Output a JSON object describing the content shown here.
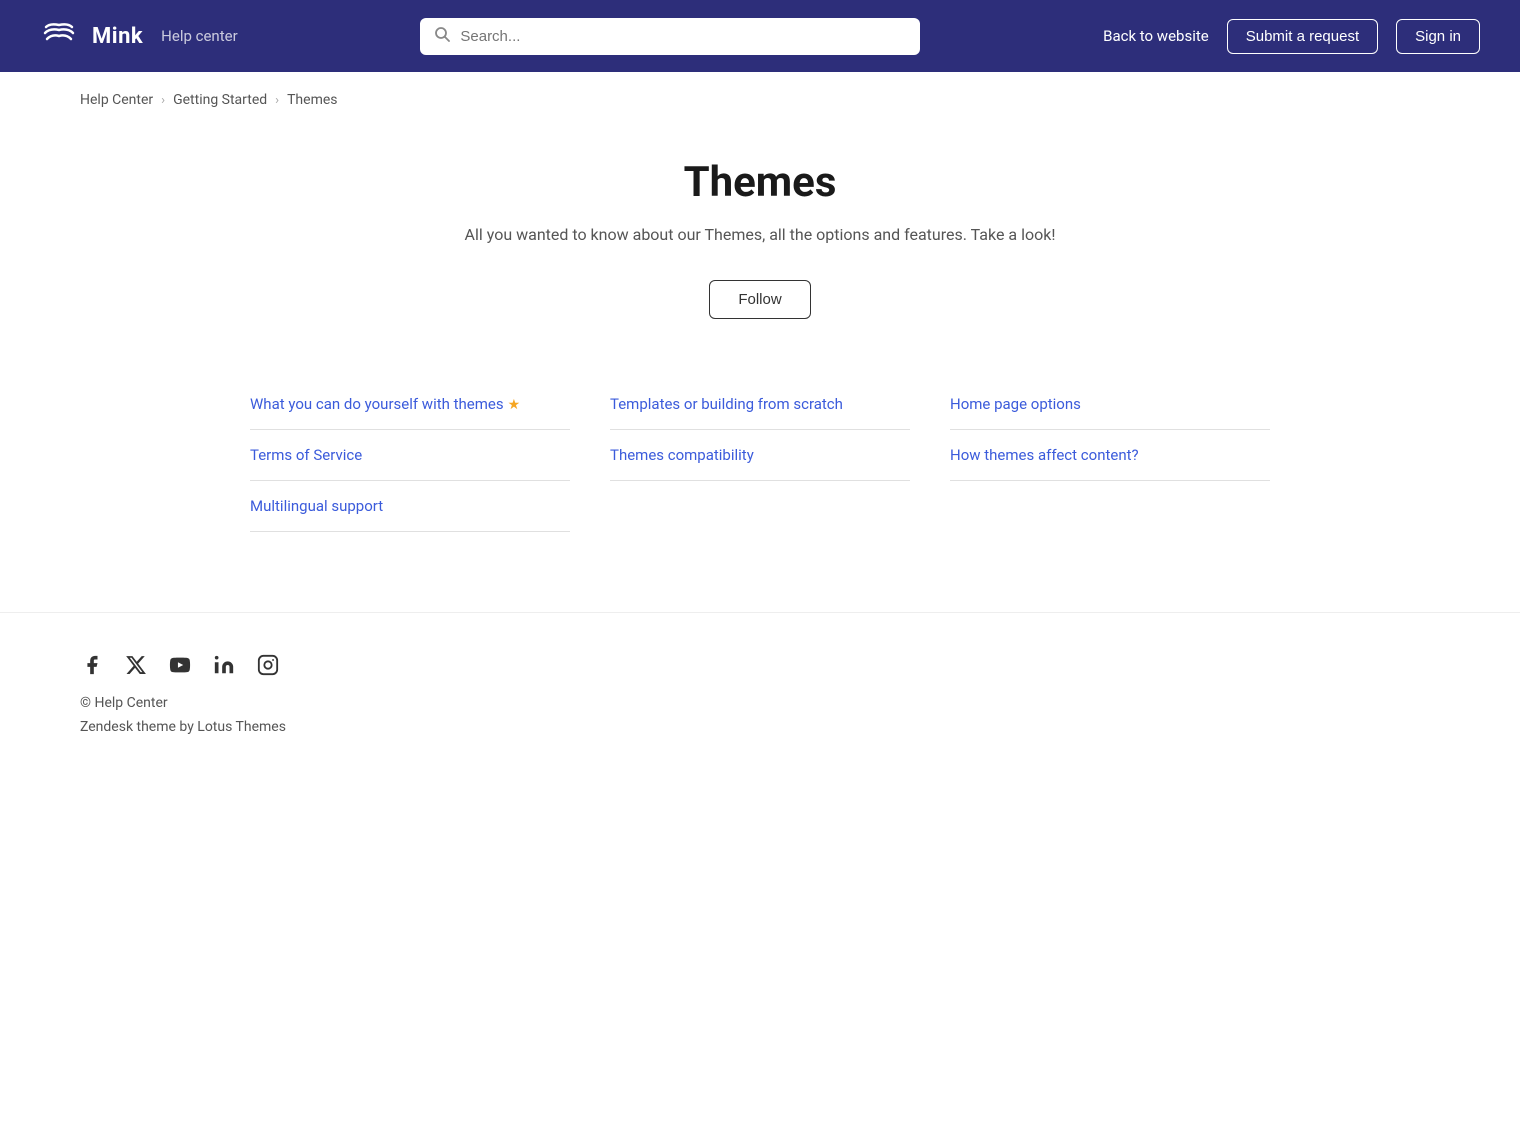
{
  "header": {
    "logo_text": "Mink",
    "help_center_label": "Help center",
    "search_placeholder": "Search...",
    "back_to_website": "Back to website",
    "submit_request": "Submit a request",
    "sign_in": "Sign in"
  },
  "breadcrumb": {
    "items": [
      {
        "label": "Help Center",
        "href": "#"
      },
      {
        "label": "Getting Started",
        "href": "#"
      },
      {
        "label": "Themes",
        "href": "#"
      }
    ]
  },
  "page": {
    "title": "Themes",
    "subtitle": "All you wanted to know about our Themes, all the options and features. Take a look!",
    "follow_label": "Follow"
  },
  "articles": {
    "columns": [
      {
        "items": [
          {
            "label": "What you can do yourself with themes",
            "star": true,
            "href": "#"
          },
          {
            "label": "Terms of Service",
            "star": false,
            "href": "#"
          },
          {
            "label": "Multilingual support",
            "star": false,
            "href": "#"
          }
        ]
      },
      {
        "items": [
          {
            "label": "Templates or building from scratch",
            "star": false,
            "href": "#"
          },
          {
            "label": "Themes compatibility",
            "star": false,
            "href": "#"
          }
        ]
      },
      {
        "items": [
          {
            "label": "Home page options",
            "star": false,
            "href": "#"
          },
          {
            "label": "How themes affect content?",
            "star": false,
            "href": "#"
          }
        ]
      }
    ]
  },
  "footer": {
    "copyright": "© Help Center",
    "theme_credit": "Zendesk theme by Lotus Themes",
    "social_icons": [
      {
        "name": "facebook-icon",
        "symbol": "f"
      },
      {
        "name": "twitter-x-icon",
        "symbol": "𝕏"
      },
      {
        "name": "youtube-icon",
        "symbol": "▶"
      },
      {
        "name": "linkedin-icon",
        "symbol": "in"
      },
      {
        "name": "instagram-icon",
        "symbol": "◻"
      }
    ]
  }
}
